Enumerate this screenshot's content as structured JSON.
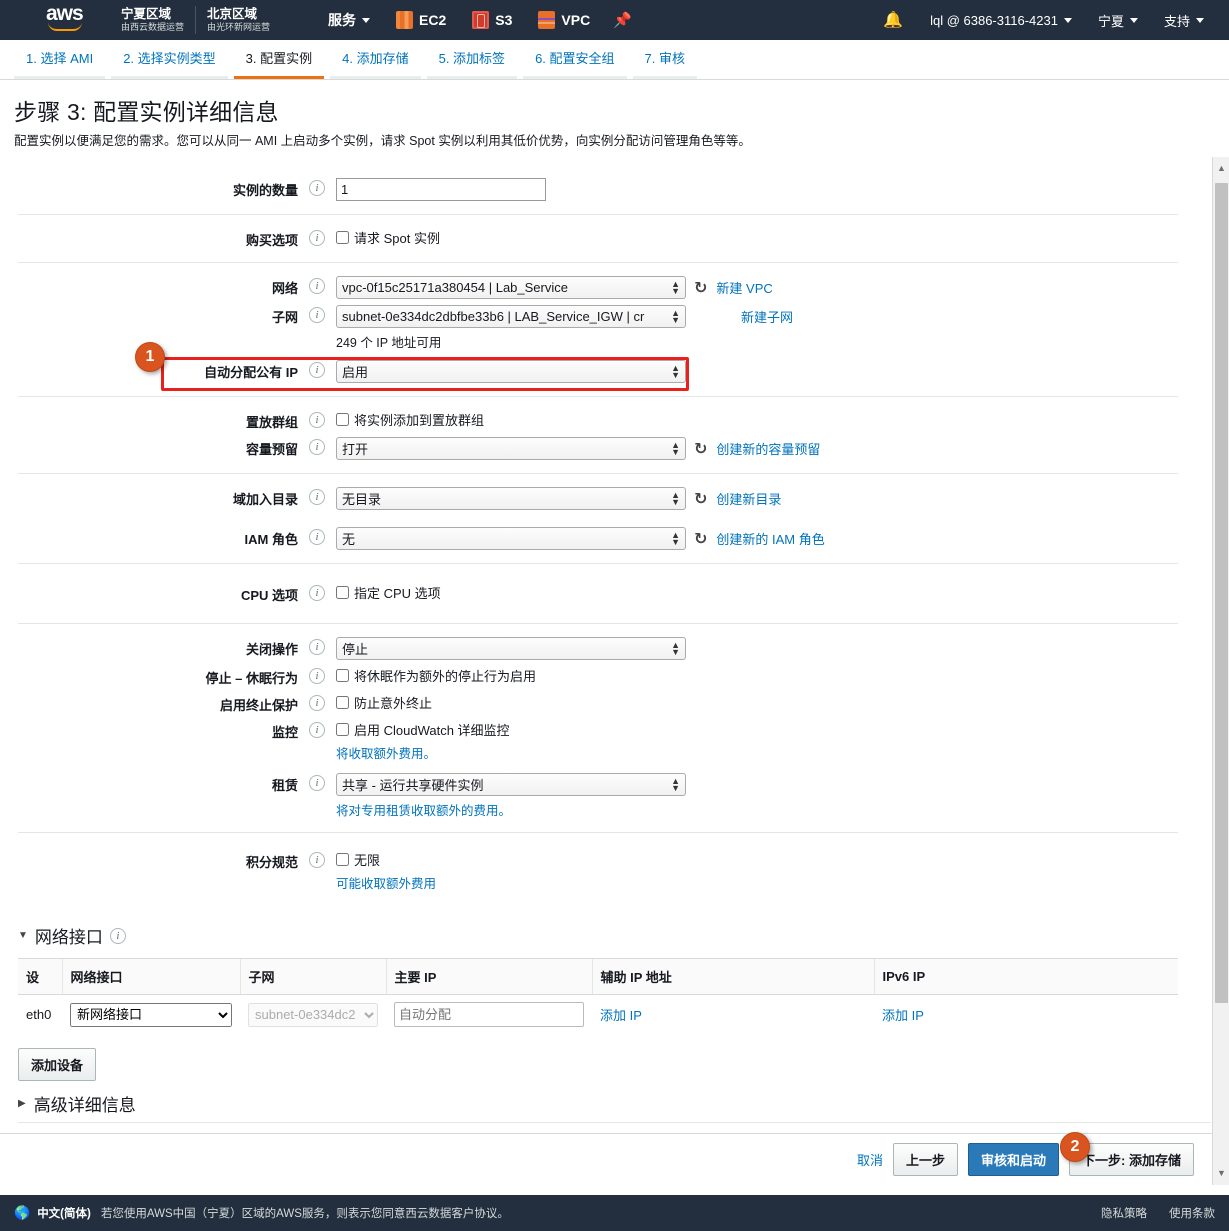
{
  "topnav": {
    "logo_text": "aws",
    "regions": [
      {
        "name": "宁夏区域",
        "operator": "由西云数据运营"
      },
      {
        "name": "北京区域",
        "operator": "由光环新网运营"
      }
    ],
    "services_label": "服务",
    "shortcuts": [
      {
        "label": "EC2",
        "icon": "ec2-icon"
      },
      {
        "label": "S3",
        "icon": "s3-icon"
      },
      {
        "label": "VPC",
        "icon": "vpc-icon"
      }
    ],
    "pin_icon": "pin-icon",
    "bell_icon": "bell-icon",
    "account": "lql @ 6386-3116-4231",
    "region_menu": "宁夏",
    "support_menu": "支持"
  },
  "steps": [
    {
      "label": "1. 选择 AMI",
      "active": false
    },
    {
      "label": "2. 选择实例类型",
      "active": false
    },
    {
      "label": "3. 配置实例",
      "active": true
    },
    {
      "label": "4. 添加存储",
      "active": false
    },
    {
      "label": "5. 添加标签",
      "active": false
    },
    {
      "label": "6. 配置安全组",
      "active": false
    },
    {
      "label": "7. 审核",
      "active": false
    }
  ],
  "page": {
    "title": "步骤 3: 配置实例详细信息",
    "description": "配置实例以便满足您的需求。您可以从同一 AMI 上启动多个实例，请求 Spot 实例以利用其低价优势，向实例分配访问管理角色等等。"
  },
  "form": {
    "instance_count": {
      "label": "实例的数量",
      "value": "1"
    },
    "purchase_option": {
      "label": "购买选项",
      "checkbox_label": "请求 Spot 实例",
      "checked": false
    },
    "network": {
      "label": "网络",
      "value": "vpc-0f15c25171a380454 | Lab_Service",
      "link": "新建 VPC",
      "refresh_icon": "refresh-icon"
    },
    "subnet": {
      "label": "子网",
      "value": "subnet-0e334dc2dbfbe33b6 | LAB_Service_IGW | cr",
      "link": "新建子网",
      "hint": "249 个 IP 地址可用"
    },
    "auto_assign_ip": {
      "label": "自动分配公有 IP",
      "value": "启用"
    },
    "placement_group": {
      "label": "置放群组",
      "checkbox_label": "将实例添加到置放群组",
      "checked": false
    },
    "capacity_reservation": {
      "label": "容量预留",
      "value": "打开",
      "link": "创建新的容量预留",
      "refresh_icon": "refresh-icon"
    },
    "domain_join": {
      "label": "域加入目录",
      "value": "无目录",
      "link": "创建新目录",
      "refresh_icon": "refresh-icon"
    },
    "iam_role": {
      "label": "IAM 角色",
      "value": "无",
      "link": "创建新的 IAM 角色",
      "refresh_icon": "refresh-icon"
    },
    "cpu_options": {
      "label": "CPU 选项",
      "checkbox_label": "指定 CPU 选项",
      "checked": false
    },
    "shutdown_behavior": {
      "label": "关闭操作",
      "value": "停止"
    },
    "hibernate": {
      "label": "停止 – 休眠行为",
      "checkbox_label": "将休眠作为额外的停止行为启用",
      "checked": false
    },
    "termination_protection": {
      "label": "启用终止保护",
      "checkbox_label": "防止意外终止",
      "checked": false
    },
    "monitoring": {
      "label": "监控",
      "checkbox_label": "启用 CloudWatch 详细监控",
      "checked": false,
      "note": "将收取额外费用。"
    },
    "tenancy": {
      "label": "租赁",
      "value": "共享 - 运行共享硬件实例",
      "note": "将对专用租赁收取额外的费用。"
    },
    "credit_spec": {
      "label": "积分规范",
      "checkbox_label": "无限",
      "checked": false,
      "note": "可能收取额外费用"
    }
  },
  "network_interfaces": {
    "section_title": "网络接口",
    "columns": [
      "设",
      "网络接口",
      "子网",
      "主要 IP",
      "辅助 IP 地址",
      "IPv6 IP"
    ],
    "rows": [
      {
        "device": "eth0",
        "interface": "新网络接口",
        "subnet": "subnet-0e334dc2",
        "primary_ip_placeholder": "自动分配",
        "secondary_ip_link": "添加 IP",
        "ipv6_link": "添加 IP"
      }
    ],
    "add_device_button": "添加设备"
  },
  "advanced": {
    "title": "高级详细信息"
  },
  "actions": {
    "cancel": "取消",
    "previous": "上一步",
    "review_launch": "审核和启动",
    "next": "下一步: 添加存储"
  },
  "annotations": [
    {
      "number": "1",
      "target": "auto-assign-public-ip-row"
    },
    {
      "number": "2",
      "target": "next-add-storage-button"
    }
  ],
  "footer": {
    "globe_icon": "globe-icon",
    "language": "中文(简体)",
    "notice": "若您使用AWS中国（宁夏）区域的AWS服务，则表示您同意",
    "notice_link": "西云数据客户协议",
    "notice_end": "。",
    "privacy": "隐私策略",
    "terms": "使用条款"
  },
  "colors": {
    "nav_bg": "#232f3e",
    "accent_orange": "#ec7211",
    "link_blue": "#0073bb",
    "annotation_red": "#e8211c",
    "badge_orange": "#d9541e"
  }
}
